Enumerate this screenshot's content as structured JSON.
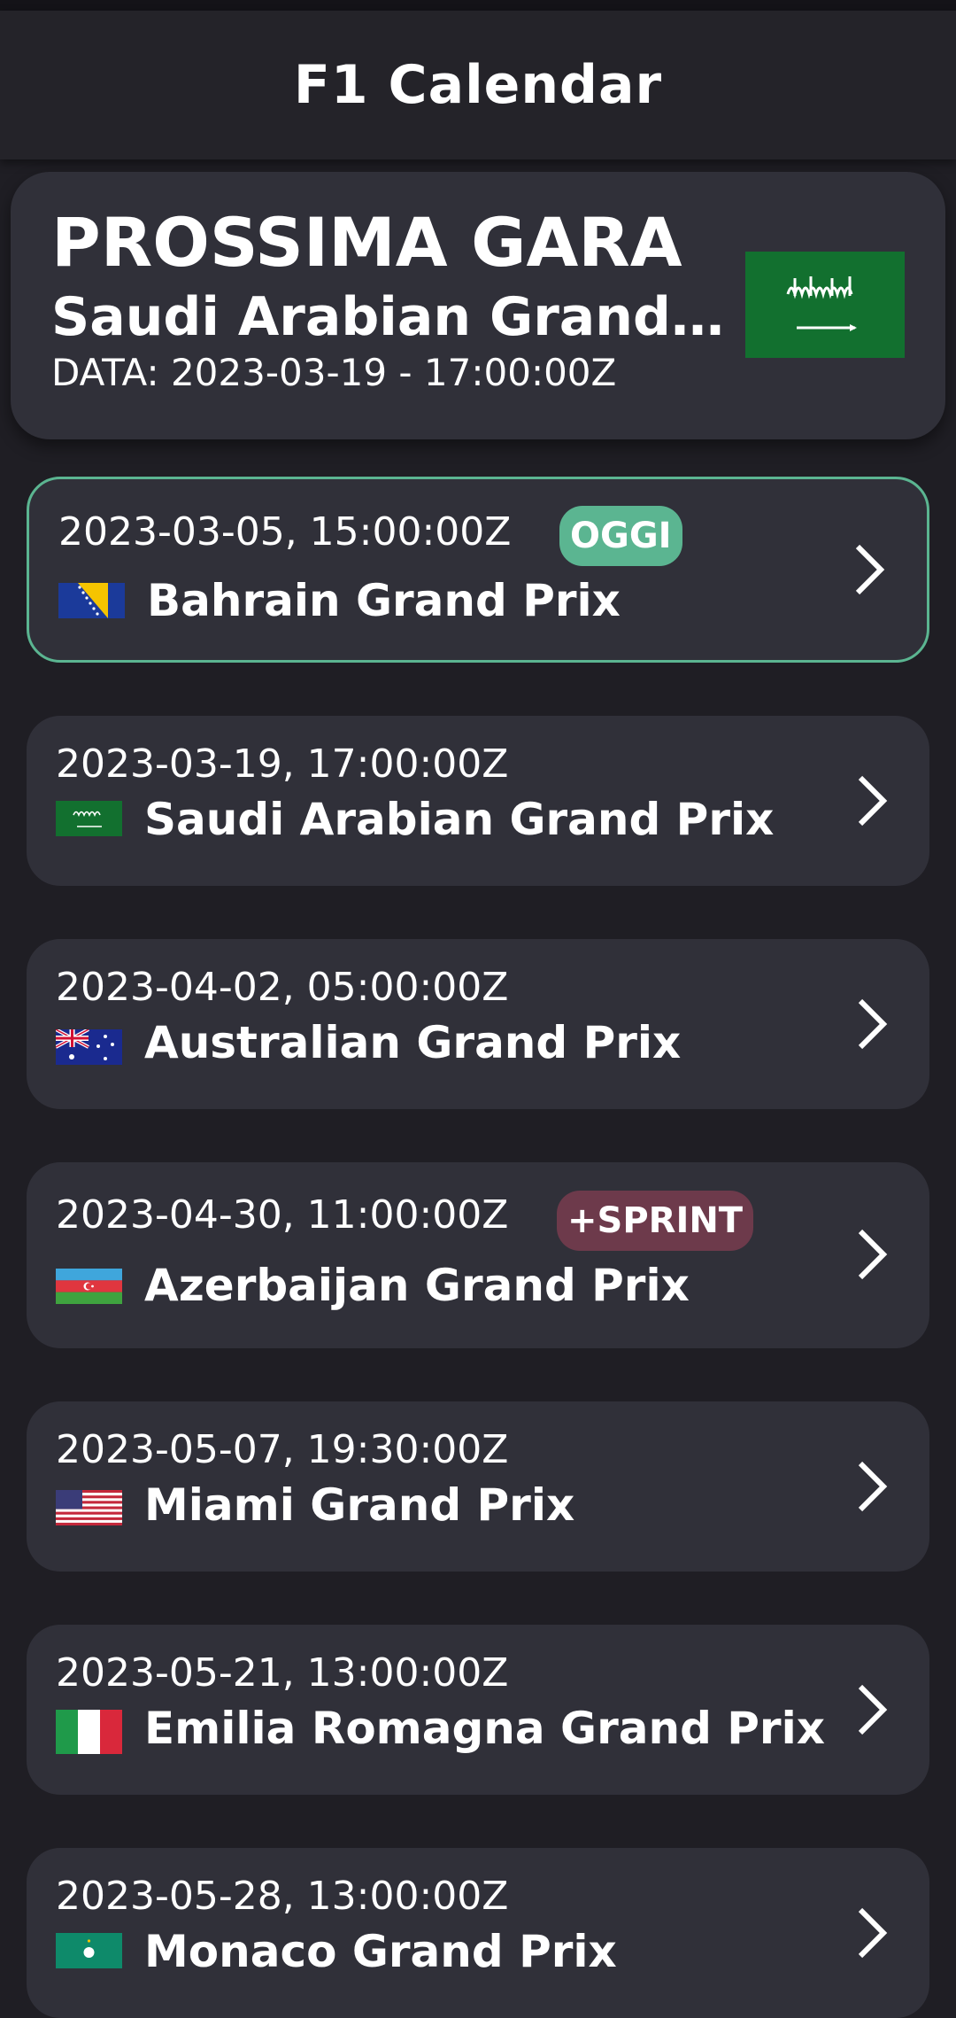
{
  "app": {
    "title": "F1 Calendar"
  },
  "next_race": {
    "heading": "PROSSIMA GARA",
    "name": "Saudi Arabian Grand Prix",
    "date_label": "DATA: 2023-03-19 - 17:00:00Z",
    "flag": "saudi-arabia-flag"
  },
  "races": [
    {
      "date": "2023-03-05, 15:00:00Z",
      "name": "Bahrain Grand Prix",
      "flag": "bosnia-flag",
      "badge": "OGGI",
      "badge_color": "#5bb591"
    },
    {
      "date": "2023-03-19, 17:00:00Z",
      "name": "Saudi Arabian Grand Prix",
      "flag": "saudi-arabia-flag"
    },
    {
      "date": "2023-04-02, 05:00:00Z",
      "name": "Australian Grand Prix",
      "flag": "australia-flag"
    },
    {
      "date": "2023-04-30, 11:00:00Z",
      "name": "Azerbaijan Grand Prix",
      "flag": "azerbaijan-flag",
      "badge": "+SPRINT",
      "badge_color": "#6d3a4b"
    },
    {
      "date": "2023-05-07, 19:30:00Z",
      "name": "Miami Grand Prix",
      "flag": "usa-flag"
    },
    {
      "date": "2023-05-21, 13:00:00Z",
      "name": "Emilia Romagna Grand Prix",
      "flag": "italy-flag"
    },
    {
      "date": "2023-05-28, 13:00:00Z",
      "name": "Monaco Grand Prix",
      "flag": "macau-flag"
    }
  ],
  "colors": {
    "background": "#1f1e24",
    "card": "#303039",
    "today_accent": "#5bb591",
    "sprint_badge": "#6d3a4b"
  }
}
